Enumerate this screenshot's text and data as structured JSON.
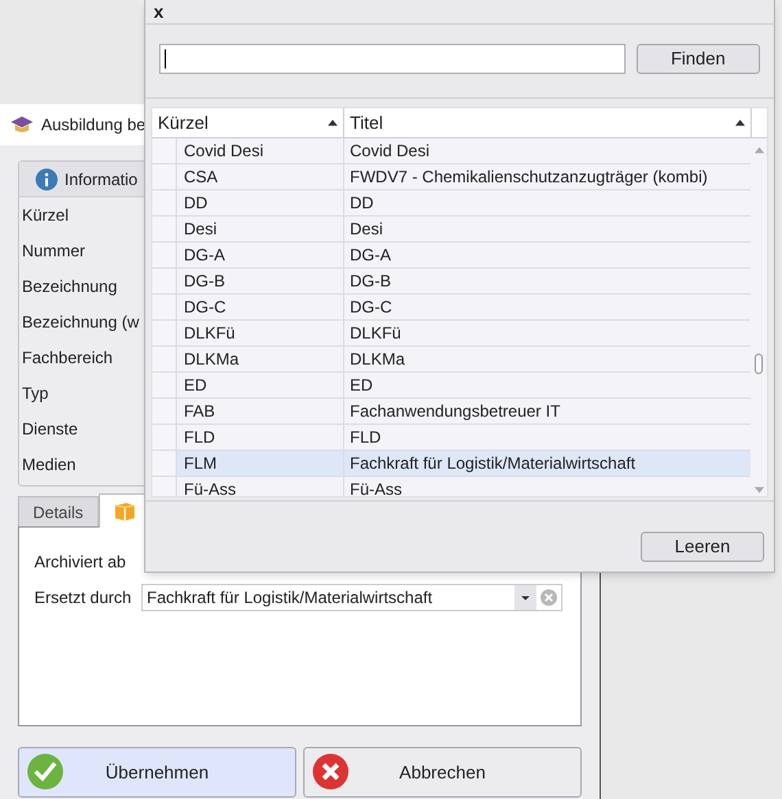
{
  "dialog": {
    "title": "Ausbildung be",
    "info_group": {
      "title": "Informatio",
      "fields": [
        "Kürzel",
        "Nummer",
        "Bezeichnung",
        "Bezeichnung (w",
        "Fachbereich",
        "Typ",
        "Dienste",
        "Medien"
      ]
    },
    "tabs": [
      {
        "kind": "text",
        "label": "Details",
        "selected": false
      },
      {
        "kind": "icon",
        "selected": true
      }
    ],
    "archive": {
      "archived_label": "Archiviert ab",
      "replaced_label": "Ersetzt durch",
      "replaced_value": "Fachkraft für Logistik/Materialwirtschaft"
    },
    "buttons": [
      {
        "kind": "ok",
        "label": "Übernehmen"
      },
      {
        "kind": "cancel",
        "label": "Abbrechen"
      }
    ]
  },
  "popup": {
    "close": "x",
    "find_button": "Finden",
    "columns": [
      {
        "label": "Kürzel",
        "sorted": true
      },
      {
        "label": "Titel",
        "sorted": true
      }
    ],
    "rows": [
      {
        "code": "Covid Desi",
        "title": "Covid Desi",
        "selected": false
      },
      {
        "code": "CSA",
        "title": "FWDV7 - Chemikalienschutzanzugträger (kombi)",
        "selected": false
      },
      {
        "code": "DD",
        "title": "DD",
        "selected": false
      },
      {
        "code": "Desi",
        "title": "Desi",
        "selected": false
      },
      {
        "code": "DG-A",
        "title": "DG-A",
        "selected": false
      },
      {
        "code": "DG-B",
        "title": "DG-B",
        "selected": false
      },
      {
        "code": "DG-C",
        "title": "DG-C",
        "selected": false
      },
      {
        "code": "DLKFü",
        "title": "DLKFü",
        "selected": false
      },
      {
        "code": "DLKMa",
        "title": "DLKMa",
        "selected": false
      },
      {
        "code": "ED",
        "title": "ED",
        "selected": false
      },
      {
        "code": "FAB",
        "title": "Fachanwendungsbetreuer IT",
        "selected": false
      },
      {
        "code": "FLD",
        "title": "FLD",
        "selected": false
      },
      {
        "code": "FLM",
        "title": "Fachkraft für Logistik/Materialwirtschaft",
        "selected": true
      },
      {
        "code": "Fü-Ass",
        "title": "Fü-Ass",
        "selected": false
      }
    ],
    "clear_button": "Leeren"
  }
}
